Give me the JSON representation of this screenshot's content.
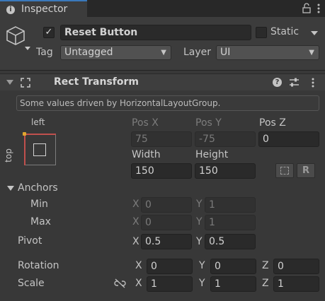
{
  "window": {
    "tab_title": "Inspector",
    "tab_icon": "info-icon",
    "lock_icon": "lock-icon",
    "menu_icon": "kebab-menu-icon"
  },
  "header": {
    "object_icon": "cube-icon",
    "active_checked": true,
    "name": "Reset Button",
    "static_label": "Static",
    "static_checked": false,
    "tag_label": "Tag",
    "tag_value": "Untagged",
    "layer_label": "Layer",
    "layer_value": "UI"
  },
  "rect_transform": {
    "title": "Rect Transform",
    "info_message": "Some values driven by HorizontalLayoutGroup.",
    "anchor_preset": {
      "h_label": "left",
      "v_label": "top"
    },
    "pos_x_label": "Pos X",
    "pos_x": "75",
    "pos_y_label": "Pos Y",
    "pos_y": "-75",
    "pos_z_label": "Pos Z",
    "pos_z": "0",
    "width_label": "Width",
    "width": "150",
    "height_label": "Height",
    "height": "150",
    "anchors_label": "Anchors",
    "min_label": "Min",
    "min_x": "0",
    "min_y": "1",
    "max_label": "Max",
    "max_x": "0",
    "max_y": "1",
    "pivot_label": "Pivot",
    "pivot_x": "0.5",
    "pivot_y": "0.5",
    "rotation_label": "Rotation",
    "rot_x": "0",
    "rot_y": "0",
    "rot_z": "0",
    "scale_label": "Scale",
    "scale_x": "1",
    "scale_y": "1",
    "scale_z": "1",
    "axis": {
      "x": "X",
      "y": "Y",
      "z": "Z"
    },
    "raw_edit_button": "R"
  },
  "colors": {
    "accent_tab": "#3a79bb",
    "background": "#383838",
    "field": "#2a2a2a"
  }
}
